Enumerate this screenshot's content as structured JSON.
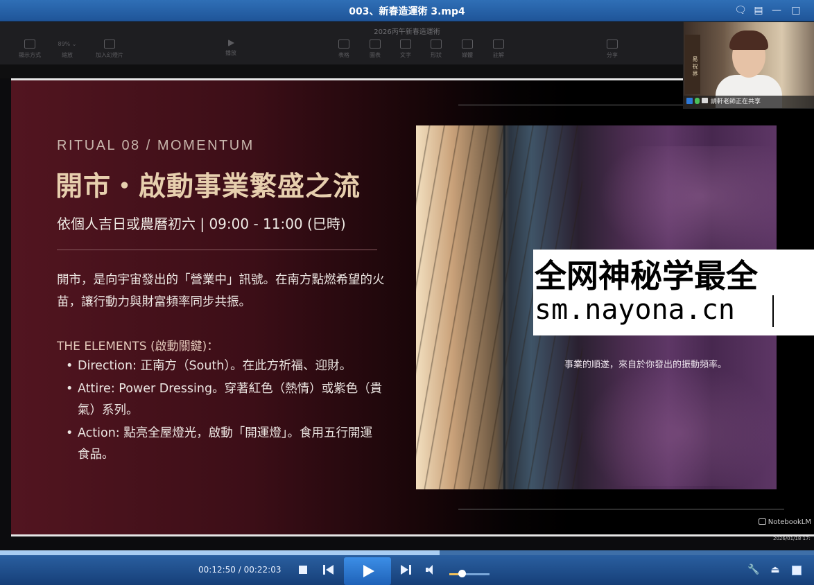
{
  "window": {
    "title": "003、新春造運術 3.mp4",
    "buttons": {
      "chat": "🗨",
      "menu": "▤",
      "minimize": "—",
      "maximize": "□"
    }
  },
  "app_toolbar": {
    "doc_title": "2026丙午新春造運術",
    "zoom": "89% ⌄",
    "tools": [
      "顯示方式",
      "縮放",
      "加入幻燈片",
      "播放",
      "表格",
      "圖表",
      "文字",
      "形狀",
      "媒體",
      "註解",
      "分享"
    ]
  },
  "slide": {
    "ritual": "RITUAL 08 / MOMENTUM",
    "headline": "開市・啟動事業繁盛之流",
    "subline": "依個人吉日或農曆初六 | 09:00 - 11:00 (巳時)",
    "paragraph": "開市，是向宇宙發出的「營業中」訊號。在南方點燃希望的火苗，讓行動力與財富頻率同步共振。",
    "elements_heading": "THE ELEMENTS (啟動關鍵)：",
    "bullets": [
      "Direction: 正南方（South）。在此方祈福、迎財。",
      "Attire: Power Dressing。穿著紅色（熱情）或紫色（貴氣）系列。",
      "Action: 點亮全屋燈光，啟動「開運燈」。食用五行開運食品。"
    ],
    "photo_caption": "事業的順遂，來自於你發出的振動頻率。",
    "brand": "NotebookLM",
    "date_stamp": "2026/01/18 17:"
  },
  "watermark": {
    "line1": "全网神秘学最全",
    "line2": "sm.nayona.cn"
  },
  "webcam": {
    "sign_text": "易 祝 界",
    "status": "請軒老師正在共享"
  },
  "player": {
    "current_time": "00:12:50",
    "total_time": "00:22:03",
    "time_separator": " / ",
    "progress": 0.54,
    "volume": 0.3,
    "right_icons": {
      "settings": "🔧",
      "eject": "⏏",
      "fullscreen": "▣"
    }
  },
  "colors": {
    "titlebar": "#2f6fb6",
    "slide_bg": "#521520",
    "headline": "#e7cfae",
    "controls": "#2a5fa0"
  }
}
